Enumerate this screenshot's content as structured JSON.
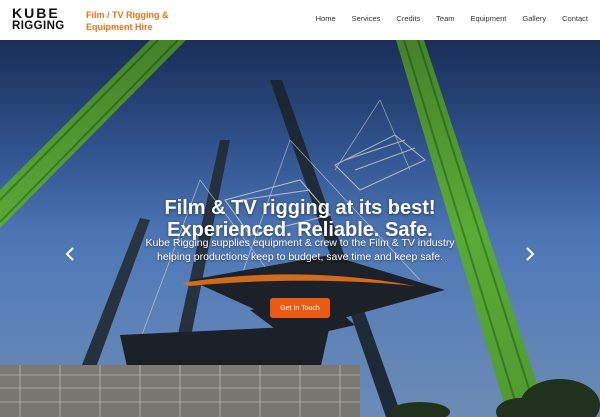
{
  "header": {
    "logo": {
      "line1": "KUBE",
      "line2": "RIGGING"
    },
    "tagline": [
      "Film / TV Rigging &",
      "Equipment Hire"
    ],
    "nav": [
      "Home",
      "Services",
      "Credits",
      "Team",
      "Equipment",
      "Gallery",
      "Contact"
    ]
  },
  "hero": {
    "title": [
      "Film & TV rigging at its best!",
      "Experienced. Reliable. Safe."
    ],
    "subtitle": [
      "Kube Rigging supplies equipment & crew to the Film & TV industry",
      "helping productions keep to budget, save time and keep safe."
    ],
    "cta_label": "Get In Touch",
    "icons": {
      "prev": "chevron-left-icon",
      "next": "chevron-right-icon"
    }
  },
  "colors": {
    "accent": "#e8731c",
    "cta": "#ea5a12",
    "crane": "#5fb43a",
    "sky_top": "#24417a",
    "sky_bottom": "#7ea3d5"
  }
}
